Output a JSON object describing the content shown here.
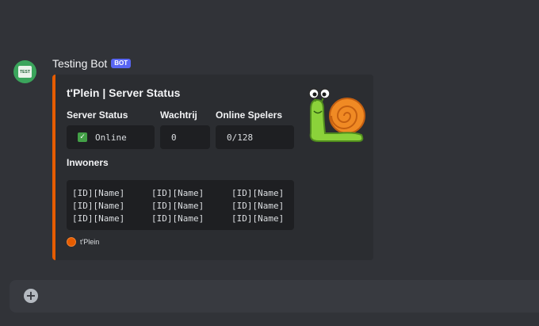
{
  "message": {
    "username": "Testing Bot",
    "badge": "BOT",
    "avatar_text": "TEST"
  },
  "embed": {
    "accent_color": "#e65c00",
    "title": "t'Plein | Server Status",
    "fields": [
      {
        "name": "Server Status",
        "value": "Online",
        "icon": "check-mark-icon"
      },
      {
        "name": "Wachtrij",
        "value": "0"
      },
      {
        "name": "Online Spelers",
        "value": "0/128"
      }
    ],
    "inwoners": {
      "name": "Inwoners",
      "rows": [
        [
          "[ID][Name]",
          "[ID][Name]",
          "[ID][Name]"
        ],
        [
          "[ID][Name]",
          "[ID][Name]",
          "[ID][Name]"
        ],
        [
          "[ID][Name]",
          "[ID][Name]",
          "[ID][Name]"
        ]
      ]
    },
    "footer": {
      "text": "t'Plein",
      "icon": "server-icon"
    },
    "thumbnail": "snail-icon"
  },
  "composer": {
    "add_icon": "plus-circle-icon"
  }
}
